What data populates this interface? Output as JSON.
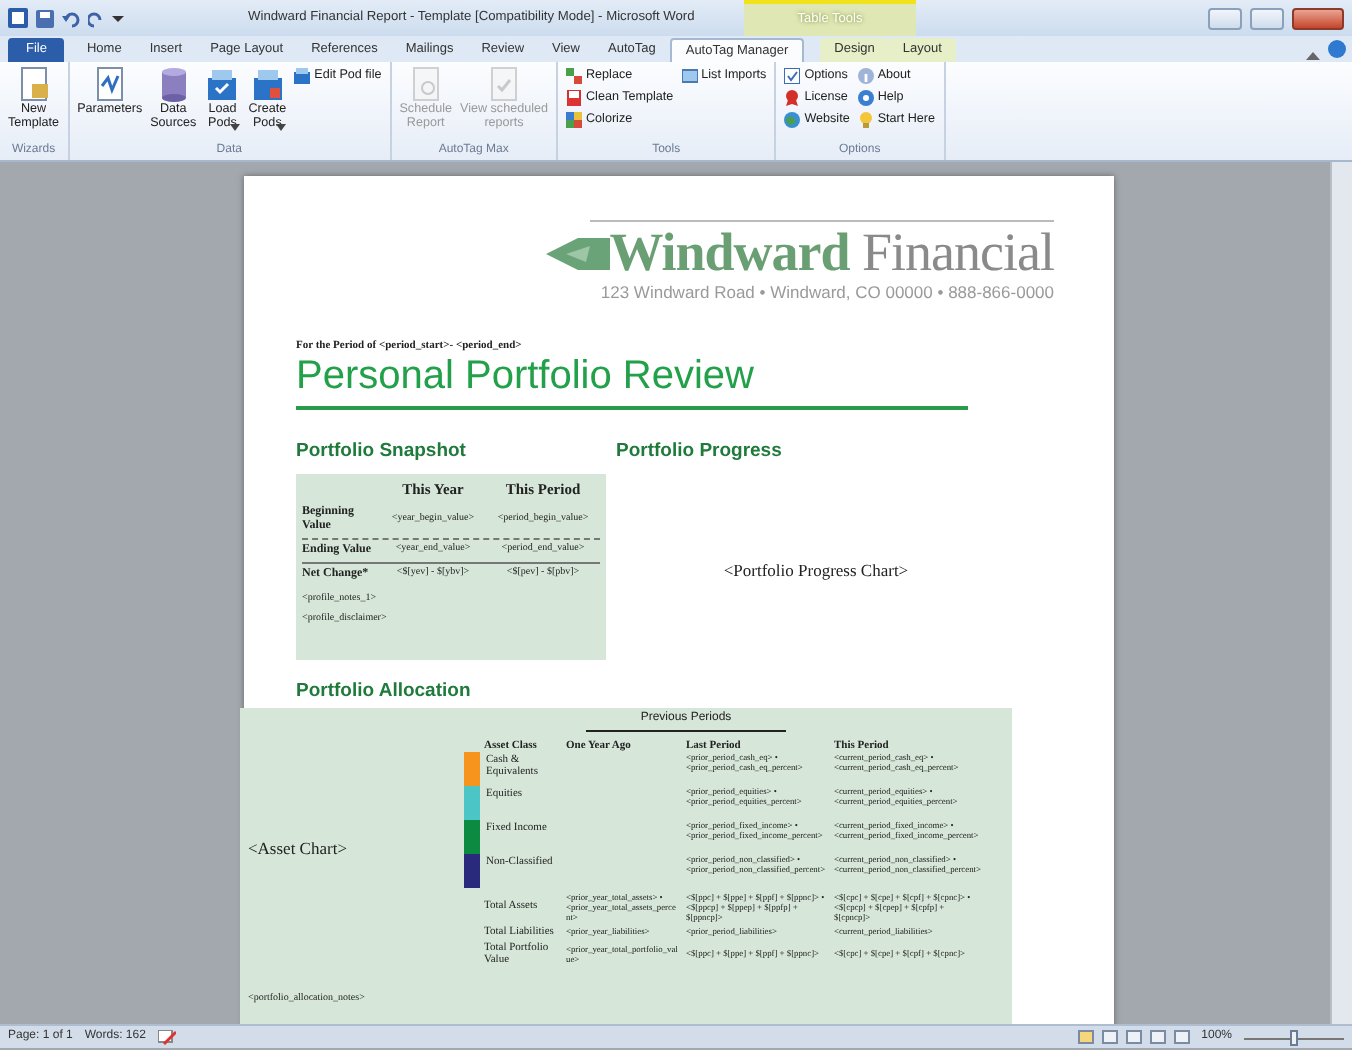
{
  "window": {
    "title": "Windward Financial Report - Template [Compatibility Mode] - Microsoft Word"
  },
  "contextual_tab": {
    "label": "Table Tools"
  },
  "tabs": [
    {
      "label": "File",
      "kind": "file",
      "selected": false
    },
    {
      "label": "Home",
      "kind": "normal",
      "selected": false
    },
    {
      "label": "Insert",
      "kind": "normal",
      "selected": false
    },
    {
      "label": "Page Layout",
      "kind": "normal",
      "selected": false
    },
    {
      "label": "References",
      "kind": "normal",
      "selected": false
    },
    {
      "label": "Mailings",
      "kind": "normal",
      "selected": false
    },
    {
      "label": "Review",
      "kind": "normal",
      "selected": false
    },
    {
      "label": "View",
      "kind": "normal",
      "selected": false
    },
    {
      "label": "AutoTag",
      "kind": "normal",
      "selected": false
    },
    {
      "label": "AutoTag Manager",
      "kind": "normal",
      "selected": true
    },
    {
      "label": "Design",
      "kind": "contextual",
      "selected": false
    },
    {
      "label": "Layout",
      "kind": "contextual",
      "selected": false
    }
  ],
  "ribbon_groups": [
    {
      "label": "Wizards",
      "items": [
        {
          "label": "New\nTemplate",
          "kind": "large",
          "disabled": false,
          "dropdown": false
        }
      ]
    },
    {
      "label": "Data",
      "items": [
        {
          "label": "Parameters",
          "kind": "large",
          "disabled": false,
          "dropdown": false
        },
        {
          "label": "Data\nSources",
          "kind": "large",
          "disabled": false,
          "dropdown": false
        },
        {
          "label": "Load\nPods",
          "kind": "large",
          "disabled": false,
          "dropdown": true
        },
        {
          "label": "Create\nPods",
          "kind": "large",
          "disabled": false,
          "dropdown": true
        },
        {
          "label": "Edit Pod file",
          "kind": "small",
          "disabled": false,
          "dropdown": false
        }
      ]
    },
    {
      "label": "AutoTag Max",
      "items": [
        {
          "label": "Schedule\nReport",
          "kind": "large",
          "disabled": true,
          "dropdown": false
        },
        {
          "label": "View scheduled\nreports",
          "kind": "large",
          "disabled": true,
          "dropdown": false
        }
      ]
    },
    {
      "label": "Tools",
      "items": [
        {
          "label": "Replace",
          "kind": "small",
          "disabled": false,
          "dropdown": false
        },
        {
          "label": "Clean Template",
          "kind": "small",
          "disabled": false,
          "dropdown": false
        },
        {
          "label": "Colorize",
          "kind": "small",
          "disabled": false,
          "dropdown": false
        },
        {
          "label": "List Imports",
          "kind": "small",
          "disabled": false,
          "dropdown": false
        }
      ]
    },
    {
      "label": "Options",
      "items": [
        {
          "label": "Options",
          "kind": "small",
          "disabled": false,
          "dropdown": false
        },
        {
          "label": "License",
          "kind": "small",
          "disabled": false,
          "dropdown": false
        },
        {
          "label": "Website",
          "kind": "small",
          "disabled": false,
          "dropdown": false
        },
        {
          "label": "About",
          "kind": "small",
          "disabled": false,
          "dropdown": false
        },
        {
          "label": "Help",
          "kind": "small",
          "disabled": false,
          "dropdown": false
        },
        {
          "label": "Start Here",
          "kind": "small",
          "disabled": false,
          "dropdown": false
        }
      ]
    }
  ],
  "document": {
    "logo": {
      "name_first": "Windward",
      "name_second": "Financial"
    },
    "address": "123 Windward Road • Windward, CO 00000 • 888-866-0000",
    "period_line": "For the Period of <period_start>- <period_end>",
    "title": "Personal Portfolio Review",
    "snapshot": {
      "heading": "Portfolio Snapshot",
      "columns": [
        "This Year",
        "This Period"
      ],
      "rows": [
        {
          "label": "Beginning Value",
          "cells": [
            "<year_begin_value>",
            "<period_begin_value>"
          ]
        },
        {
          "label": "Ending Value",
          "cells": [
            "<year_end_value>",
            "<period_end_value>"
          ]
        },
        {
          "label": "Net Change*",
          "cells": [
            "<$[yev] - $[ybv]>",
            "<$[pev] - $[pbv]>"
          ]
        }
      ],
      "notes": [
        "<profile_notes_1>",
        "<profile_disclaimer>"
      ]
    },
    "progress": {
      "heading": "Portfolio Progress",
      "chart_placeholder": "<Portfolio Progress Chart>"
    },
    "allocation": {
      "heading": "Portfolio Allocation",
      "chart_placeholder": "<Asset Chart>",
      "group_header": "Previous Periods",
      "columns": [
        "Asset Class",
        "One Year Ago",
        "Last Period",
        "This Period"
      ],
      "classes": [
        {
          "label": "Cash & Equivalents",
          "color": "#f7941d",
          "last_period": [
            "<prior_period_cash_eq> •",
            "<prior_period_cash_eq_percent>"
          ],
          "this_period": [
            "<current_period_cash_eq> •",
            "<current_period_cash_eq_percent>"
          ]
        },
        {
          "label": "Equities",
          "color": "#4bc5c5",
          "last_period": [
            "<prior_period_equities> •",
            "<prior_period_equities_percent>"
          ],
          "this_period": [
            "<current_period_equities> •",
            "<current_period_equities_percent>"
          ]
        },
        {
          "label": "Fixed Income",
          "color": "#0d8a42",
          "last_period": [
            "<prior_period_fixed_income> •",
            "<prior_period_fixed_income_percent>"
          ],
          "this_period": [
            "<current_period_fixed_income> •",
            "<current_period_fixed_income_percent>"
          ]
        },
        {
          "label": "Non-Classified",
          "color": "#2a2a7c",
          "last_period": [
            "<prior_period_non_classified> •",
            "<prior_period_non_classified_percent>"
          ],
          "this_period": [
            "<current_period_non_classified> •",
            "<current_period_non_classified_percent>"
          ]
        }
      ],
      "totals": [
        {
          "label": "Total Assets",
          "one_year_ago": "<prior_year_total_assets> • <prior_year_total_assets_percent>",
          "last_period": "<$[ppc] + $[ppe] + $[ppf] + $[ppnc]> • <$[ppcp] + $[ppep] + $[ppfp] + $[ppncp]>",
          "this_period": "<$[cpc] + $[cpe] + $[cpf] + $[cpnc]> • <$[cpcp] + $[cpep] + $[cpfp] + $[cpncp]>"
        },
        {
          "label": "Total Liabilities",
          "one_year_ago": "<prior_year_liabilities>",
          "last_period": "<prior_period_liabilities>",
          "this_period": "<current_period_liabilities>"
        },
        {
          "label": "Total Portfolio Value",
          "one_year_ago": "<prior_year_total_portfolio_value>",
          "last_period": "<$[ppc] + $[ppe] + $[ppf] + $[ppnc]>",
          "this_period": "<$[cpc] + $[cpe] + $[cpf] + $[cpnc]>"
        }
      ],
      "notes": "<portfolio_allocation_notes>"
    }
  },
  "status_bar": {
    "page": "Page: 1 of 1",
    "words": "Words: 162",
    "zoom": "100%",
    "zoom_slider": {
      "level": 0.5
    }
  }
}
